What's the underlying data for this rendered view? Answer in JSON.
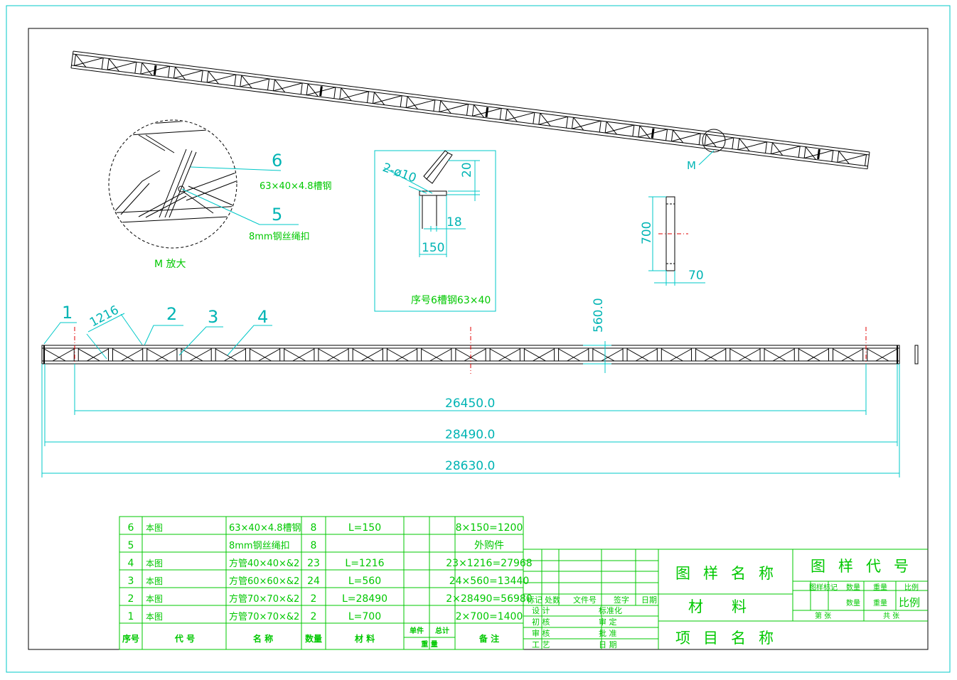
{
  "colors": {
    "dimension": "#00c8c8",
    "table": "#00c800",
    "outline": "#000000",
    "center": "#e00000"
  },
  "detail": {
    "title": "M 放大",
    "callout_6_num": "6",
    "callout_6_text": "63×40×4.8槽钢",
    "callout_5_num": "5",
    "callout_5_text": "8mm钢丝绳扣",
    "callout_m": "M"
  },
  "channel_detail": {
    "hole_label": "2-ø10",
    "dim_20": "20",
    "dim_18": "18",
    "dim_150": "150",
    "caption": "序号6槽钢63×40"
  },
  "end_view": {
    "dim_700": "700",
    "dim_70": "70"
  },
  "elevation": {
    "callouts": [
      "1",
      "2",
      "3",
      "4"
    ],
    "panel_dim": "1216",
    "height_dim": "560.0",
    "dims": [
      "26450.0",
      "28490.0",
      "28630.0"
    ]
  },
  "bom": {
    "rows": [
      {
        "no": "6",
        "code": "本图",
        "name": "63×40×4.8槽钢",
        "qty": "8",
        "material": "L=150",
        "note": "8×150=1200"
      },
      {
        "no": "5",
        "code": "",
        "name": "8mm钢丝绳扣",
        "qty": "8",
        "material": "",
        "note": "外购件"
      },
      {
        "no": "4",
        "code": "本图",
        "name": "方管40×40×&2",
        "qty": "23",
        "material": "L=1216",
        "note": "23×1216=27968"
      },
      {
        "no": "3",
        "code": "本图",
        "name": "方管60×60×&2",
        "qty": "24",
        "material": "L=560",
        "note": "24×560=13440"
      },
      {
        "no": "2",
        "code": "本图",
        "name": "方管70×70×&2",
        "qty": "2",
        "material": "L=28490",
        "note": "2×28490=56980"
      },
      {
        "no": "1",
        "code": "本图",
        "name": "方管70×70×&2",
        "qty": "2",
        "material": "L=700",
        "note": "2×700=1400"
      }
    ],
    "header": {
      "no": "序号",
      "code": "代  号",
      "name": "名  称",
      "qty": "数量",
      "material": "材  料",
      "unit": "单件",
      "total": "总计",
      "weight": "重  量",
      "note": "备  注"
    }
  },
  "title_block": {
    "drawing_name": "图样名称",
    "drawing_code": "图样代号",
    "material": "材料",
    "project_name": "项目名称",
    "mark": "图样标记",
    "quantity": "数量",
    "weight": "重量",
    "scale": "比例",
    "quantity2": "数量",
    "weight2": "重量",
    "scale2": "比例",
    "sheet": "第  张",
    "total_sheets": "共  张",
    "rev_mark": "标记",
    "rev_count": "处数",
    "rev_file": "文件号",
    "rev_sign": "签字",
    "rev_date": "日期",
    "design": "设 计",
    "draft": "初 核",
    "review": "审 核",
    "process": "工 艺",
    "standard": "标准化",
    "audit": "审 定",
    "approve": "批 准",
    "date": "日 期"
  }
}
